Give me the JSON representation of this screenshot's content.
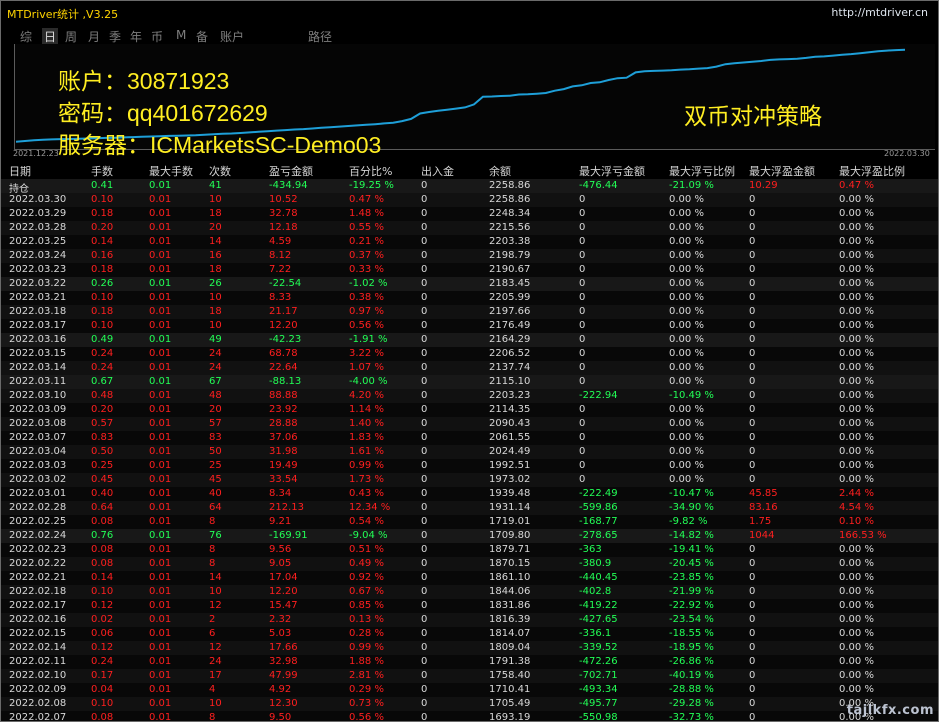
{
  "window": {
    "title": "MTDriver统计 ,V3.25",
    "url": "http://mtdriver.cn"
  },
  "periods": {
    "items": [
      "综",
      "日",
      "周",
      "月",
      "季",
      "年",
      "币",
      "M",
      "备",
      "账户",
      "路径"
    ],
    "active": "日"
  },
  "overlay": {
    "account": "账户：30871923",
    "password": "密码：qq401672629",
    "server": "服务器：ICMarketsSC-Demo03",
    "strategy": "双币对冲策略"
  },
  "chart_data": {
    "type": "line",
    "x_start_label": "2021.12.23",
    "x_end_label": "2022.03.30",
    "y_min": 1640,
    "y_max": 2270,
    "values": [
      1655,
      1660,
      1665,
      1668,
      1670,
      1672,
      1673,
      1675,
      1676,
      1678,
      1680,
      1681,
      1683,
      1685,
      1687,
      1689,
      1691,
      1693,
      1694,
      1696,
      1698,
      1701,
      1704,
      1707,
      1709,
      1712,
      1716,
      1720,
      1724,
      1728,
      1731,
      1735,
      1738,
      1742,
      1746,
      1750,
      1754,
      1758,
      1762,
      1766,
      1770,
      1775,
      1780,
      1790,
      1805,
      1840,
      1850,
      1858,
      1865,
      1872,
      1880,
      1900,
      1950,
      1952,
      1955,
      1957,
      1965,
      1966,
      1970,
      1975,
      1990,
      2000,
      2018,
      2025,
      2040,
      2045,
      2060,
      2072,
      2075,
      2110,
      2118,
      2120,
      2122,
      2124,
      2128,
      2130,
      2135,
      2138,
      2148,
      2164,
      2170,
      2175,
      2180,
      2185,
      2192,
      2195,
      2197,
      2200,
      2205,
      2212,
      2215,
      2220,
      2226,
      2230,
      2236,
      2242,
      2249,
      2253,
      2256,
      2258
    ]
  },
  "table": {
    "columns": [
      "日期",
      "手数",
      "最大手数",
      "次数",
      "盈亏金额",
      "百分比%",
      "出入金",
      "余额",
      "最大浮亏金额",
      "最大浮亏比例",
      "最大浮盈金额",
      "最大浮盈比例"
    ],
    "rows": [
      {
        "date": "持仓",
        "lots": "0.41",
        "max_lots": "0.01",
        "count": "41",
        "pnl": "-434.94",
        "pct": "-19.25 %",
        "io": "0",
        "balance": "2258.86",
        "max_dd": "-476.44",
        "max_dd_pct": "-21.09 %",
        "max_fp": "10.29",
        "max_fp_pct": "0.47 %",
        "tone": "g",
        "dd_tone": "g",
        "fp_tone": "r"
      },
      {
        "date": "2022.03.30",
        "lots": "0.10",
        "max_lots": "0.01",
        "count": "10",
        "pnl": "10.52",
        "pct": "0.47 %",
        "io": "0",
        "balance": "2258.86",
        "max_dd": "0",
        "max_dd_pct": "0.00 %",
        "max_fp": "0",
        "max_fp_pct": "0.00 %",
        "tone": "r",
        "dd_tone": "w",
        "fp_tone": "w"
      },
      {
        "date": "2022.03.29",
        "lots": "0.18",
        "max_lots": "0.01",
        "count": "18",
        "pnl": "32.78",
        "pct": "1.48 %",
        "io": "0",
        "balance": "2248.34",
        "max_dd": "0",
        "max_dd_pct": "0.00 %",
        "max_fp": "0",
        "max_fp_pct": "0.00 %",
        "tone": "r",
        "dd_tone": "w",
        "fp_tone": "w"
      },
      {
        "date": "2022.03.28",
        "lots": "0.20",
        "max_lots": "0.01",
        "count": "20",
        "pnl": "12.18",
        "pct": "0.55 %",
        "io": "0",
        "balance": "2215.56",
        "max_dd": "0",
        "max_dd_pct": "0.00 %",
        "max_fp": "0",
        "max_fp_pct": "0.00 %",
        "tone": "r",
        "dd_tone": "w",
        "fp_tone": "w"
      },
      {
        "date": "2022.03.25",
        "lots": "0.14",
        "max_lots": "0.01",
        "count": "14",
        "pnl": "4.59",
        "pct": "0.21 %",
        "io": "0",
        "balance": "2203.38",
        "max_dd": "0",
        "max_dd_pct": "0.00 %",
        "max_fp": "0",
        "max_fp_pct": "0.00 %",
        "tone": "r",
        "dd_tone": "w",
        "fp_tone": "w"
      },
      {
        "date": "2022.03.24",
        "lots": "0.16",
        "max_lots": "0.01",
        "count": "16",
        "pnl": "8.12",
        "pct": "0.37 %",
        "io": "0",
        "balance": "2198.79",
        "max_dd": "0",
        "max_dd_pct": "0.00 %",
        "max_fp": "0",
        "max_fp_pct": "0.00 %",
        "tone": "r",
        "dd_tone": "w",
        "fp_tone": "w"
      },
      {
        "date": "2022.03.23",
        "lots": "0.18",
        "max_lots": "0.01",
        "count": "18",
        "pnl": "7.22",
        "pct": "0.33 %",
        "io": "0",
        "balance": "2190.67",
        "max_dd": "0",
        "max_dd_pct": "0.00 %",
        "max_fp": "0",
        "max_fp_pct": "0.00 %",
        "tone": "r",
        "dd_tone": "w",
        "fp_tone": "w"
      },
      {
        "date": "2022.03.22",
        "lots": "0.26",
        "max_lots": "0.01",
        "count": "26",
        "pnl": "-22.54",
        "pct": "-1.02 %",
        "io": "0",
        "balance": "2183.45",
        "max_dd": "0",
        "max_dd_pct": "0.00 %",
        "max_fp": "0",
        "max_fp_pct": "0.00 %",
        "tone": "g",
        "dd_tone": "w",
        "fp_tone": "w"
      },
      {
        "date": "2022.03.21",
        "lots": "0.10",
        "max_lots": "0.01",
        "count": "10",
        "pnl": "8.33",
        "pct": "0.38 %",
        "io": "0",
        "balance": "2205.99",
        "max_dd": "0",
        "max_dd_pct": "0.00 %",
        "max_fp": "0",
        "max_fp_pct": "0.00 %",
        "tone": "r",
        "dd_tone": "w",
        "fp_tone": "w"
      },
      {
        "date": "2022.03.18",
        "lots": "0.18",
        "max_lots": "0.01",
        "count": "18",
        "pnl": "21.17",
        "pct": "0.97 %",
        "io": "0",
        "balance": "2197.66",
        "max_dd": "0",
        "max_dd_pct": "0.00 %",
        "max_fp": "0",
        "max_fp_pct": "0.00 %",
        "tone": "r",
        "dd_tone": "w",
        "fp_tone": "w"
      },
      {
        "date": "2022.03.17",
        "lots": "0.10",
        "max_lots": "0.01",
        "count": "10",
        "pnl": "12.20",
        "pct": "0.56 %",
        "io": "0",
        "balance": "2176.49",
        "max_dd": "0",
        "max_dd_pct": "0.00 %",
        "max_fp": "0",
        "max_fp_pct": "0.00 %",
        "tone": "r",
        "dd_tone": "w",
        "fp_tone": "w"
      },
      {
        "date": "2022.03.16",
        "lots": "0.49",
        "max_lots": "0.01",
        "count": "49",
        "pnl": "-42.23",
        "pct": "-1.91 %",
        "io": "0",
        "balance": "2164.29",
        "max_dd": "0",
        "max_dd_pct": "0.00 %",
        "max_fp": "0",
        "max_fp_pct": "0.00 %",
        "tone": "g",
        "dd_tone": "w",
        "fp_tone": "w"
      },
      {
        "date": "2022.03.15",
        "lots": "0.24",
        "max_lots": "0.01",
        "count": "24",
        "pnl": "68.78",
        "pct": "3.22 %",
        "io": "0",
        "balance": "2206.52",
        "max_dd": "0",
        "max_dd_pct": "0.00 %",
        "max_fp": "0",
        "max_fp_pct": "0.00 %",
        "tone": "r",
        "dd_tone": "w",
        "fp_tone": "w"
      },
      {
        "date": "2022.03.14",
        "lots": "0.24",
        "max_lots": "0.01",
        "count": "24",
        "pnl": "22.64",
        "pct": "1.07 %",
        "io": "0",
        "balance": "2137.74",
        "max_dd": "0",
        "max_dd_pct": "0.00 %",
        "max_fp": "0",
        "max_fp_pct": "0.00 %",
        "tone": "r",
        "dd_tone": "w",
        "fp_tone": "w"
      },
      {
        "date": "2022.03.11",
        "lots": "0.67",
        "max_lots": "0.01",
        "count": "67",
        "pnl": "-88.13",
        "pct": "-4.00 %",
        "io": "0",
        "balance": "2115.10",
        "max_dd": "0",
        "max_dd_pct": "0.00 %",
        "max_fp": "0",
        "max_fp_pct": "0.00 %",
        "tone": "g",
        "dd_tone": "w",
        "fp_tone": "w"
      },
      {
        "date": "2022.03.10",
        "lots": "0.48",
        "max_lots": "0.01",
        "count": "48",
        "pnl": "88.88",
        "pct": "4.20 %",
        "io": "0",
        "balance": "2203.23",
        "max_dd": "-222.94",
        "max_dd_pct": "-10.49 %",
        "max_fp": "0",
        "max_fp_pct": "0.00 %",
        "tone": "r",
        "dd_tone": "g",
        "fp_tone": "w"
      },
      {
        "date": "2022.03.09",
        "lots": "0.20",
        "max_lots": "0.01",
        "count": "20",
        "pnl": "23.92",
        "pct": "1.14 %",
        "io": "0",
        "balance": "2114.35",
        "max_dd": "0",
        "max_dd_pct": "0.00 %",
        "max_fp": "0",
        "max_fp_pct": "0.00 %",
        "tone": "r",
        "dd_tone": "w",
        "fp_tone": "w"
      },
      {
        "date": "2022.03.08",
        "lots": "0.57",
        "max_lots": "0.01",
        "count": "57",
        "pnl": "28.88",
        "pct": "1.40 %",
        "io": "0",
        "balance": "2090.43",
        "max_dd": "0",
        "max_dd_pct": "0.00 %",
        "max_fp": "0",
        "max_fp_pct": "0.00 %",
        "tone": "r",
        "dd_tone": "w",
        "fp_tone": "w"
      },
      {
        "date": "2022.03.07",
        "lots": "0.83",
        "max_lots": "0.01",
        "count": "83",
        "pnl": "37.06",
        "pct": "1.83 %",
        "io": "0",
        "balance": "2061.55",
        "max_dd": "0",
        "max_dd_pct": "0.00 %",
        "max_fp": "0",
        "max_fp_pct": "0.00 %",
        "tone": "r",
        "dd_tone": "w",
        "fp_tone": "w"
      },
      {
        "date": "2022.03.04",
        "lots": "0.50",
        "max_lots": "0.01",
        "count": "50",
        "pnl": "31.98",
        "pct": "1.61 %",
        "io": "0",
        "balance": "2024.49",
        "max_dd": "0",
        "max_dd_pct": "0.00 %",
        "max_fp": "0",
        "max_fp_pct": "0.00 %",
        "tone": "r",
        "dd_tone": "w",
        "fp_tone": "w"
      },
      {
        "date": "2022.03.03",
        "lots": "0.25",
        "max_lots": "0.01",
        "count": "25",
        "pnl": "19.49",
        "pct": "0.99 %",
        "io": "0",
        "balance": "1992.51",
        "max_dd": "0",
        "max_dd_pct": "0.00 %",
        "max_fp": "0",
        "max_fp_pct": "0.00 %",
        "tone": "r",
        "dd_tone": "w",
        "fp_tone": "w"
      },
      {
        "date": "2022.03.02",
        "lots": "0.45",
        "max_lots": "0.01",
        "count": "45",
        "pnl": "33.54",
        "pct": "1.73 %",
        "io": "0",
        "balance": "1973.02",
        "max_dd": "0",
        "max_dd_pct": "0.00 %",
        "max_fp": "0",
        "max_fp_pct": "0.00 %",
        "tone": "r",
        "dd_tone": "w",
        "fp_tone": "w"
      },
      {
        "date": "2022.03.01",
        "lots": "0.40",
        "max_lots": "0.01",
        "count": "40",
        "pnl": "8.34",
        "pct": "0.43 %",
        "io": "0",
        "balance": "1939.48",
        "max_dd": "-222.49",
        "max_dd_pct": "-10.47 %",
        "max_fp": "45.85",
        "max_fp_pct": "2.44 %",
        "tone": "r",
        "dd_tone": "g",
        "fp_tone": "r"
      },
      {
        "date": "2022.02.28",
        "lots": "0.64",
        "max_lots": "0.01",
        "count": "64",
        "pnl": "212.13",
        "pct": "12.34 %",
        "io": "0",
        "balance": "1931.14",
        "max_dd": "-599.86",
        "max_dd_pct": "-34.90 %",
        "max_fp": "83.16",
        "max_fp_pct": "4.54 %",
        "tone": "r",
        "dd_tone": "g",
        "fp_tone": "r"
      },
      {
        "date": "2022.02.25",
        "lots": "0.08",
        "max_lots": "0.01",
        "count": "8",
        "pnl": "9.21",
        "pct": "0.54 %",
        "io": "0",
        "balance": "1719.01",
        "max_dd": "-168.77",
        "max_dd_pct": "-9.82 %",
        "max_fp": "1.75",
        "max_fp_pct": "0.10 %",
        "tone": "r",
        "dd_tone": "g",
        "fp_tone": "r"
      },
      {
        "date": "2022.02.24",
        "lots": "0.76",
        "max_lots": "0.01",
        "count": "76",
        "pnl": "-169.91",
        "pct": "-9.04 %",
        "io": "0",
        "balance": "1709.80",
        "max_dd": "-278.65",
        "max_dd_pct": "-14.82 %",
        "max_fp": "1044",
        "max_fp_pct": "166.53 %",
        "tone": "g",
        "dd_tone": "g",
        "fp_tone": "r"
      },
      {
        "date": "2022.02.23",
        "lots": "0.08",
        "max_lots": "0.01",
        "count": "8",
        "pnl": "9.56",
        "pct": "0.51 %",
        "io": "0",
        "balance": "1879.71",
        "max_dd": "-363",
        "max_dd_pct": "-19.41 %",
        "max_fp": "0",
        "max_fp_pct": "0.00 %",
        "tone": "r",
        "dd_tone": "g",
        "fp_tone": "w"
      },
      {
        "date": "2022.02.22",
        "lots": "0.08",
        "max_lots": "0.01",
        "count": "8",
        "pnl": "9.05",
        "pct": "0.49 %",
        "io": "0",
        "balance": "1870.15",
        "max_dd": "-380.9",
        "max_dd_pct": "-20.45 %",
        "max_fp": "0",
        "max_fp_pct": "0.00 %",
        "tone": "r",
        "dd_tone": "g",
        "fp_tone": "w"
      },
      {
        "date": "2022.02.21",
        "lots": "0.14",
        "max_lots": "0.01",
        "count": "14",
        "pnl": "17.04",
        "pct": "0.92 %",
        "io": "0",
        "balance": "1861.10",
        "max_dd": "-440.45",
        "max_dd_pct": "-23.85 %",
        "max_fp": "0",
        "max_fp_pct": "0.00 %",
        "tone": "r",
        "dd_tone": "g",
        "fp_tone": "w"
      },
      {
        "date": "2022.02.18",
        "lots": "0.10",
        "max_lots": "0.01",
        "count": "10",
        "pnl": "12.20",
        "pct": "0.67 %",
        "io": "0",
        "balance": "1844.06",
        "max_dd": "-402.8",
        "max_dd_pct": "-21.99 %",
        "max_fp": "0",
        "max_fp_pct": "0.00 %",
        "tone": "r",
        "dd_tone": "g",
        "fp_tone": "w"
      },
      {
        "date": "2022.02.17",
        "lots": "0.12",
        "max_lots": "0.01",
        "count": "12",
        "pnl": "15.47",
        "pct": "0.85 %",
        "io": "0",
        "balance": "1831.86",
        "max_dd": "-419.22",
        "max_dd_pct": "-22.92 %",
        "max_fp": "0",
        "max_fp_pct": "0.00 %",
        "tone": "r",
        "dd_tone": "g",
        "fp_tone": "w"
      },
      {
        "date": "2022.02.16",
        "lots": "0.02",
        "max_lots": "0.01",
        "count": "2",
        "pnl": "2.32",
        "pct": "0.13 %",
        "io": "0",
        "balance": "1816.39",
        "max_dd": "-427.65",
        "max_dd_pct": "-23.54 %",
        "max_fp": "0",
        "max_fp_pct": "0.00 %",
        "tone": "r",
        "dd_tone": "g",
        "fp_tone": "w"
      },
      {
        "date": "2022.02.15",
        "lots": "0.06",
        "max_lots": "0.01",
        "count": "6",
        "pnl": "5.03",
        "pct": "0.28 %",
        "io": "0",
        "balance": "1814.07",
        "max_dd": "-336.1",
        "max_dd_pct": "-18.55 %",
        "max_fp": "0",
        "max_fp_pct": "0.00 %",
        "tone": "r",
        "dd_tone": "g",
        "fp_tone": "w"
      },
      {
        "date": "2022.02.14",
        "lots": "0.12",
        "max_lots": "0.01",
        "count": "12",
        "pnl": "17.66",
        "pct": "0.99 %",
        "io": "0",
        "balance": "1809.04",
        "max_dd": "-339.52",
        "max_dd_pct": "-18.95 %",
        "max_fp": "0",
        "max_fp_pct": "0.00 %",
        "tone": "r",
        "dd_tone": "g",
        "fp_tone": "w"
      },
      {
        "date": "2022.02.11",
        "lots": "0.24",
        "max_lots": "0.01",
        "count": "24",
        "pnl": "32.98",
        "pct": "1.88 %",
        "io": "0",
        "balance": "1791.38",
        "max_dd": "-472.26",
        "max_dd_pct": "-26.86 %",
        "max_fp": "0",
        "max_fp_pct": "0.00 %",
        "tone": "r",
        "dd_tone": "g",
        "fp_tone": "w"
      },
      {
        "date": "2022.02.10",
        "lots": "0.17",
        "max_lots": "0.01",
        "count": "17",
        "pnl": "47.99",
        "pct": "2.81 %",
        "io": "0",
        "balance": "1758.40",
        "max_dd": "-702.71",
        "max_dd_pct": "-40.19 %",
        "max_fp": "0",
        "max_fp_pct": "0.00 %",
        "tone": "r",
        "dd_tone": "g",
        "fp_tone": "w"
      },
      {
        "date": "2022.02.09",
        "lots": "0.04",
        "max_lots": "0.01",
        "count": "4",
        "pnl": "4.92",
        "pct": "0.29 %",
        "io": "0",
        "balance": "1710.41",
        "max_dd": "-493.34",
        "max_dd_pct": "-28.88 %",
        "max_fp": "0",
        "max_fp_pct": "0.00 %",
        "tone": "r",
        "dd_tone": "g",
        "fp_tone": "w"
      },
      {
        "date": "2022.02.08",
        "lots": "0.10",
        "max_lots": "0.01",
        "count": "10",
        "pnl": "12.30",
        "pct": "0.73 %",
        "io": "0",
        "balance": "1705.49",
        "max_dd": "-495.77",
        "max_dd_pct": "-29.28 %",
        "max_fp": "0",
        "max_fp_pct": "0.00 %",
        "tone": "r",
        "dd_tone": "g",
        "fp_tone": "w"
      },
      {
        "date": "2022.02.07",
        "lots": "0.08",
        "max_lots": "0.01",
        "count": "8",
        "pnl": "9.50",
        "pct": "0.56 %",
        "io": "0",
        "balance": "1693.19",
        "max_dd": "-550.98",
        "max_dd_pct": "-32.73 %",
        "max_fp": "0",
        "max_fp_pct": "0.00 %",
        "tone": "r",
        "dd_tone": "g",
        "fp_tone": "w"
      }
    ]
  },
  "watermark": "tajlkfx.com",
  "colors": {
    "profit": "#ff1f1f",
    "loss": "#22ff56",
    "neutral": "#d8d8d8",
    "overlay_text": "#ffee22",
    "equity_line": "#1e9fd8",
    "title": "#ffd400"
  }
}
